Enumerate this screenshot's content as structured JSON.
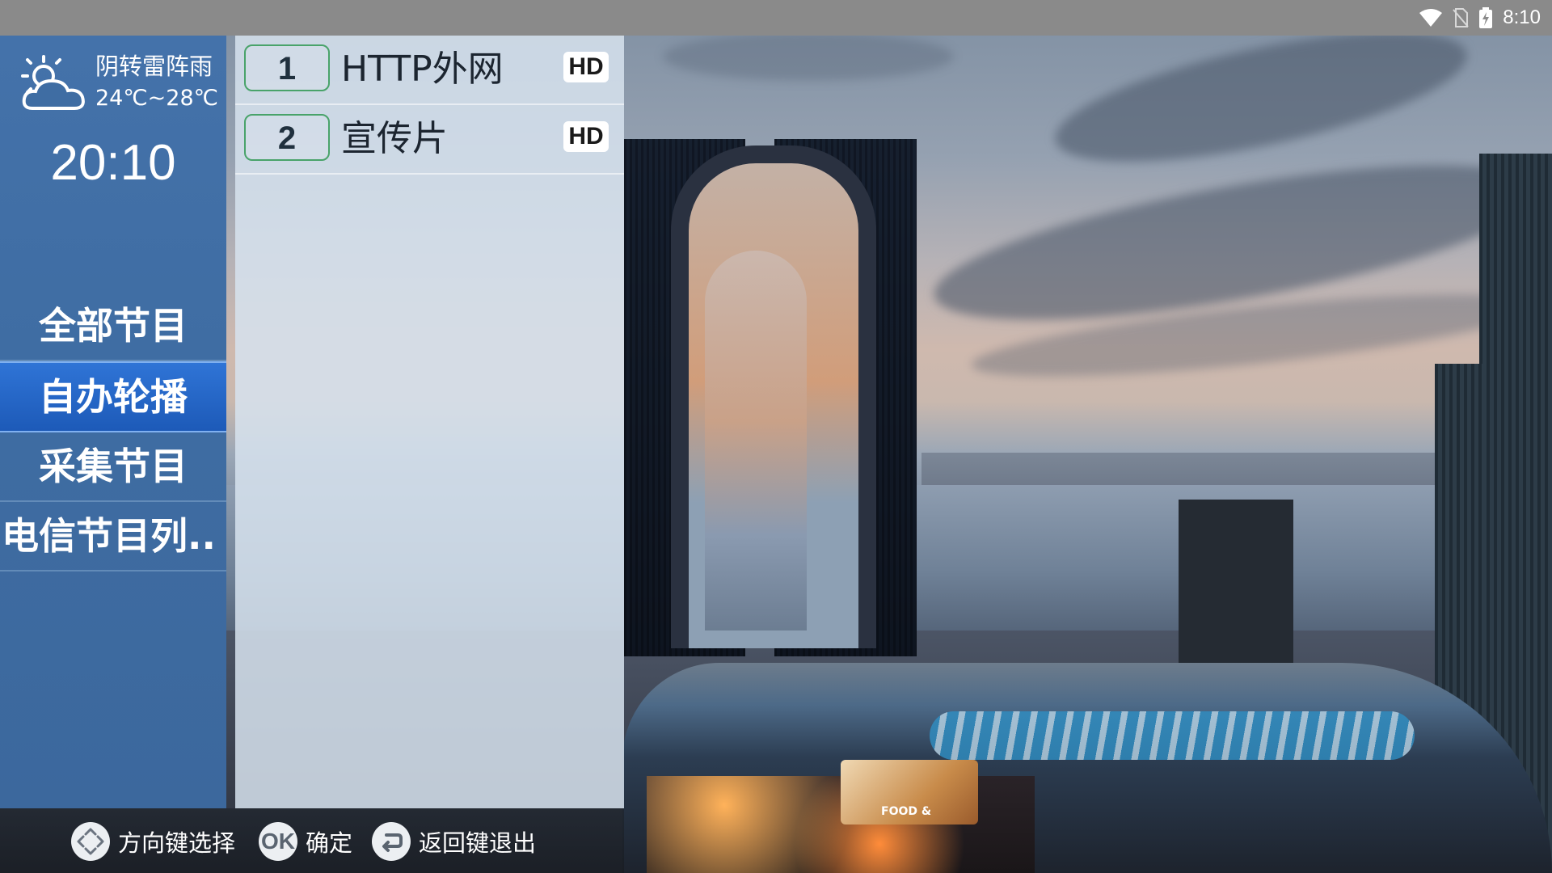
{
  "status_bar": {
    "time": "8:10"
  },
  "weather": {
    "condition": "阴转雷阵雨",
    "temperature": "24℃~28℃"
  },
  "clock": "20:10",
  "menu": {
    "items": [
      {
        "label": "全部节目"
      },
      {
        "label": "自办轮播"
      },
      {
        "label": "采集节目"
      },
      {
        "label": "电信节目列.."
      }
    ]
  },
  "channels": [
    {
      "number": "1",
      "name": "HTTP外网",
      "badge": "HD"
    },
    {
      "number": "2",
      "name": "宣传片",
      "badge": "HD"
    }
  ],
  "help": {
    "direction_label": "方向键选择",
    "ok_icon_text": "OK",
    "ok_label": "确定",
    "back_label": "返回键退出"
  },
  "scene": {
    "billboard_text": "FOOD &"
  },
  "colors": {
    "sidebar_bg": "#4472aa",
    "selected_item": "#2f74d6",
    "channel_number_border": "#49a36a"
  }
}
